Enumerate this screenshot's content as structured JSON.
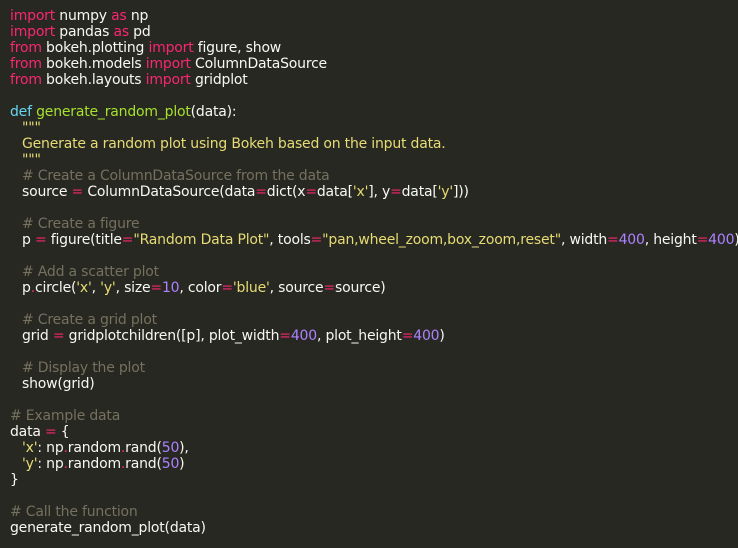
{
  "editor": {
    "language": "python",
    "theme_colors": {
      "background": "#272822",
      "text": "#f8f8f2",
      "keyword": "#f92672",
      "definition": "#66d9ef",
      "function_name": "#a6e22e",
      "string": "#e6db74",
      "number": "#ae81ff",
      "comment": "#75715e"
    },
    "lines": [
      [
        {
          "t": "kw",
          "v": "import"
        },
        {
          "t": "pl",
          "v": " numpy "
        },
        {
          "t": "kw",
          "v": "as"
        },
        {
          "t": "pl",
          "v": " np"
        }
      ],
      [
        {
          "t": "kw",
          "v": "import"
        },
        {
          "t": "pl",
          "v": " pandas "
        },
        {
          "t": "kw",
          "v": "as"
        },
        {
          "t": "pl",
          "v": " pd"
        }
      ],
      [
        {
          "t": "kw",
          "v": "from"
        },
        {
          "t": "pl",
          "v": " bokeh.plotting "
        },
        {
          "t": "kw",
          "v": "import"
        },
        {
          "t": "pl",
          "v": " figure, show"
        }
      ],
      [
        {
          "t": "kw",
          "v": "from"
        },
        {
          "t": "pl",
          "v": " bokeh.models "
        },
        {
          "t": "kw",
          "v": "import"
        },
        {
          "t": "pl",
          "v": " ColumnDataSource"
        }
      ],
      [
        {
          "t": "kw",
          "v": "from"
        },
        {
          "t": "pl",
          "v": " bokeh.layouts "
        },
        {
          "t": "kw",
          "v": "import"
        },
        {
          "t": "pl",
          "v": " gridplot"
        }
      ],
      [],
      [
        {
          "t": "def",
          "v": "def"
        },
        {
          "t": "pl",
          "v": " "
        },
        {
          "t": "fn",
          "v": "generate_random_plot"
        },
        {
          "t": "pl",
          "v": "(data):"
        }
      ],
      [
        {
          "t": "ind"
        },
        {
          "t": "str",
          "v": "\"\"\""
        }
      ],
      [
        {
          "t": "ind"
        },
        {
          "t": "str",
          "v": "Generate a random plot using Bokeh based on the input data."
        }
      ],
      [
        {
          "t": "ind"
        },
        {
          "t": "str",
          "v": "\"\"\""
        }
      ],
      [
        {
          "t": "ind"
        },
        {
          "t": "cm",
          "v": "# Create a ColumnDataSource from the data"
        }
      ],
      [
        {
          "t": "ind"
        },
        {
          "t": "pl",
          "v": "source "
        },
        {
          "t": "op",
          "v": "="
        },
        {
          "t": "pl",
          "v": " ColumnDataSource(data"
        },
        {
          "t": "op",
          "v": "="
        },
        {
          "t": "pl",
          "v": "dict(x"
        },
        {
          "t": "op",
          "v": "="
        },
        {
          "t": "pl",
          "v": "data["
        },
        {
          "t": "str",
          "v": "'x'"
        },
        {
          "t": "pl",
          "v": "], y"
        },
        {
          "t": "op",
          "v": "="
        },
        {
          "t": "pl",
          "v": "data["
        },
        {
          "t": "str",
          "v": "'y'"
        },
        {
          "t": "pl",
          "v": "]))"
        }
      ],
      [],
      [
        {
          "t": "ind"
        },
        {
          "t": "cm",
          "v": "# Create a figure"
        }
      ],
      [
        {
          "t": "ind"
        },
        {
          "t": "pl",
          "v": "p "
        },
        {
          "t": "op",
          "v": "="
        },
        {
          "t": "pl",
          "v": " figure(title"
        },
        {
          "t": "op",
          "v": "="
        },
        {
          "t": "str",
          "v": "\"Random Data Plot\""
        },
        {
          "t": "pl",
          "v": ", tools"
        },
        {
          "t": "op",
          "v": "="
        },
        {
          "t": "str",
          "v": "\"pan,wheel_zoom,box_zoom,reset\""
        },
        {
          "t": "pl",
          "v": ", width"
        },
        {
          "t": "op",
          "v": "="
        },
        {
          "t": "num",
          "v": "400"
        },
        {
          "t": "pl",
          "v": ", height"
        },
        {
          "t": "op",
          "v": "="
        },
        {
          "t": "num",
          "v": "400"
        },
        {
          "t": "pl",
          "v": ")"
        }
      ],
      [],
      [
        {
          "t": "ind"
        },
        {
          "t": "cm",
          "v": "# Add a scatter plot"
        }
      ],
      [
        {
          "t": "ind"
        },
        {
          "t": "pl",
          "v": "p"
        },
        {
          "t": "op",
          "v": "."
        },
        {
          "t": "pl",
          "v": "circle("
        },
        {
          "t": "str",
          "v": "'x'"
        },
        {
          "t": "pl",
          "v": ", "
        },
        {
          "t": "str",
          "v": "'y'"
        },
        {
          "t": "pl",
          "v": ", size"
        },
        {
          "t": "op",
          "v": "="
        },
        {
          "t": "num",
          "v": "10"
        },
        {
          "t": "pl",
          "v": ", color"
        },
        {
          "t": "op",
          "v": "="
        },
        {
          "t": "str",
          "v": "'blue'"
        },
        {
          "t": "pl",
          "v": ", source"
        },
        {
          "t": "op",
          "v": "="
        },
        {
          "t": "pl",
          "v": "source)"
        }
      ],
      [],
      [
        {
          "t": "ind"
        },
        {
          "t": "cm",
          "v": "# Create a grid plot"
        }
      ],
      [
        {
          "t": "ind"
        },
        {
          "t": "pl",
          "v": "grid "
        },
        {
          "t": "op",
          "v": "="
        },
        {
          "t": "pl",
          "v": " gridplotchildren([p], plot_width"
        },
        {
          "t": "op",
          "v": "="
        },
        {
          "t": "num",
          "v": "400"
        },
        {
          "t": "pl",
          "v": ", plot_height"
        },
        {
          "t": "op",
          "v": "="
        },
        {
          "t": "num",
          "v": "400"
        },
        {
          "t": "pl",
          "v": ")"
        }
      ],
      [],
      [
        {
          "t": "ind"
        },
        {
          "t": "cm",
          "v": "# Display the plot"
        }
      ],
      [
        {
          "t": "ind"
        },
        {
          "t": "pl",
          "v": "show(grid)"
        }
      ],
      [],
      [
        {
          "t": "cm",
          "v": "# Example data"
        }
      ],
      [
        {
          "t": "pl",
          "v": "data "
        },
        {
          "t": "op",
          "v": "="
        },
        {
          "t": "pl",
          "v": " {"
        }
      ],
      [
        {
          "t": "ind"
        },
        {
          "t": "str",
          "v": "'x'"
        },
        {
          "t": "pl",
          "v": ": np"
        },
        {
          "t": "op",
          "v": "."
        },
        {
          "t": "pl",
          "v": "random"
        },
        {
          "t": "op",
          "v": "."
        },
        {
          "t": "pl",
          "v": "rand("
        },
        {
          "t": "num",
          "v": "50"
        },
        {
          "t": "pl",
          "v": "),"
        }
      ],
      [
        {
          "t": "ind"
        },
        {
          "t": "str",
          "v": "'y'"
        },
        {
          "t": "pl",
          "v": ": np"
        },
        {
          "t": "op",
          "v": "."
        },
        {
          "t": "pl",
          "v": "random"
        },
        {
          "t": "op",
          "v": "."
        },
        {
          "t": "pl",
          "v": "rand("
        },
        {
          "t": "num",
          "v": "50"
        },
        {
          "t": "pl",
          "v": ")"
        }
      ],
      [
        {
          "t": "pl",
          "v": "}"
        }
      ],
      [],
      [
        {
          "t": "cm",
          "v": "# Call the function"
        }
      ],
      [
        {
          "t": "pl",
          "v": "generate_random_plot(data)"
        }
      ]
    ]
  }
}
